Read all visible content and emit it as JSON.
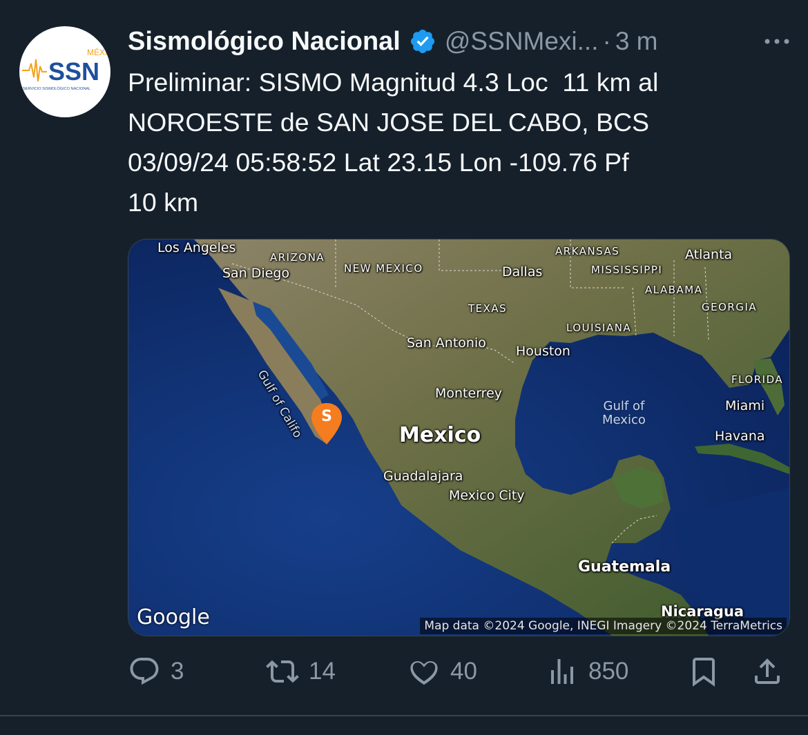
{
  "tweet": {
    "author_name": "Sismológico Nacional",
    "handle": "@SSNMexi...",
    "separator": "·",
    "time": "3 m",
    "text": "Preliminar: SISMO Magnitud 4.3 Loc  11 km al\nNOROESTE de SAN JOSE DEL CABO, BCS\n03/09/24 05:58:52 Lat 23.15 Lon -109.76 Pf\n10 km",
    "avatar": {
      "top_text": "MÉXICO",
      "main_text": "SSN",
      "sub_text": "SERVICIO SISMOLÓGICO NACIONAL"
    },
    "icons": {
      "verified": "verified-badge-icon",
      "more": "more-horizontal-icon"
    },
    "colors": {
      "background": "#15202b",
      "muted": "#8b98a5",
      "verified": "#1d9bf0",
      "pin": "#f57c1f",
      "avatar_blue": "#1e4f9c"
    }
  },
  "map": {
    "labels": {
      "los_angeles": "Los Angeles",
      "san_diego": "San Diego",
      "arizona": "ARIZONA",
      "new_mexico": "NEW MEXICO",
      "arkansas": "ARKANSAS",
      "atlanta": "Atlanta",
      "mississippi": "MISSISSIPPI",
      "dallas": "Dallas",
      "alabama": "ALABAMA",
      "texas": "TEXAS",
      "georgia": "GEORGIA",
      "louisiana": "LOUISIANA",
      "san_antonio": "San Antonio",
      "houston": "Houston",
      "gulf_of_california": "Gulf of Califo",
      "florida": "FLORIDA",
      "gulf_of_mexico": "Gulf of\nMexico",
      "monterrey": "Monterrey",
      "miami": "Miami",
      "mexico": "Mexico",
      "havana": "Havana",
      "guadalajara": "Guadalajara",
      "mexico_city": "Mexico City",
      "guatemala": "Guatemala",
      "nicaragua": "Nicaragua"
    },
    "pin_letter": "S",
    "google_logo": "Google",
    "attribution": "Map data ©2024 Google, INEGI Imagery ©2024 TerraMetrics"
  },
  "actions": {
    "reply": {
      "icon": "reply-icon",
      "count": "3"
    },
    "retweet": {
      "icon": "retweet-icon",
      "count": "14"
    },
    "like": {
      "icon": "heart-icon",
      "count": "40"
    },
    "views": {
      "icon": "views-bar-chart-icon",
      "count": "850"
    },
    "bookmark": {
      "icon": "bookmark-icon"
    },
    "share": {
      "icon": "share-icon"
    }
  }
}
